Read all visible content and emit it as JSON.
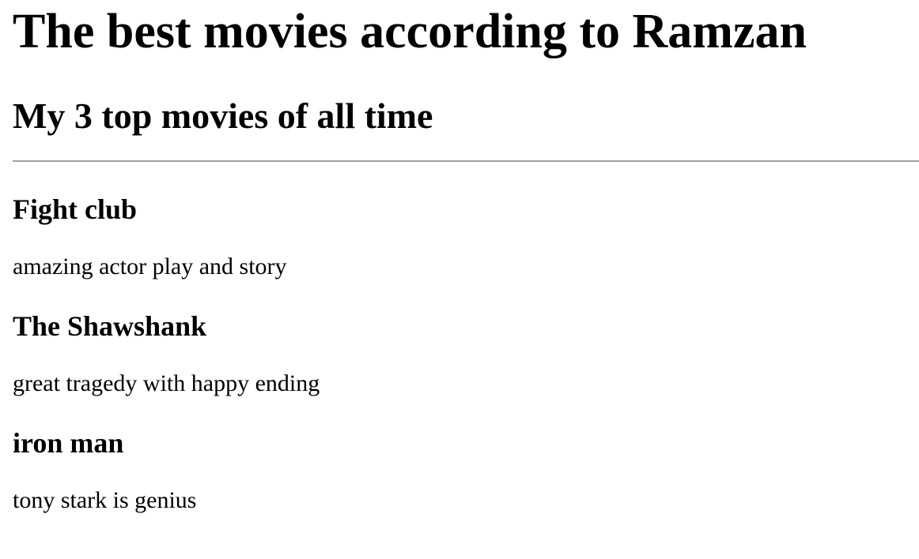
{
  "page": {
    "title": "The best movies according to Ramzan",
    "subtitle": "My 3 top movies of all time"
  },
  "movies": [
    {
      "title": "Fight club",
      "description": "amazing actor play and story"
    },
    {
      "title": "The Shawshank",
      "description": "great tragedy with happy ending"
    },
    {
      "title": "iron man",
      "description": "tony stark is genius"
    }
  ]
}
